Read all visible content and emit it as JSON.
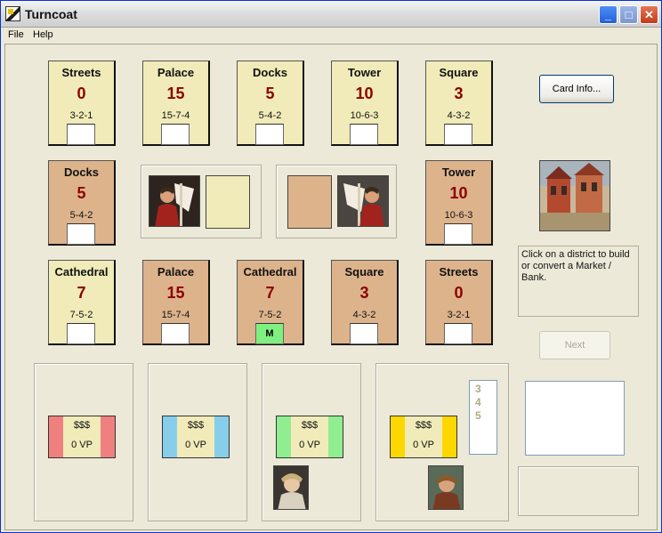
{
  "window": {
    "title": "Turncoat"
  },
  "menu": {
    "file": "File",
    "help": "Help"
  },
  "title_buttons": {
    "minimize": "_",
    "maximize": "□",
    "close": "✕"
  },
  "districts": [
    {
      "name": "Streets",
      "value": "0",
      "points": "3-2-1",
      "color": "yellow",
      "slot": ""
    },
    {
      "name": "Palace",
      "value": "15",
      "points": "15-7-4",
      "color": "yellow",
      "slot": ""
    },
    {
      "name": "Docks",
      "value": "5",
      "points": "5-4-2",
      "color": "yellow",
      "slot": ""
    },
    {
      "name": "Tower",
      "value": "10",
      "points": "10-6-3",
      "color": "yellow",
      "slot": ""
    },
    {
      "name": "Square",
      "value": "3",
      "points": "4-3-2",
      "color": "yellow",
      "slot": ""
    },
    {
      "name": "Docks",
      "value": "5",
      "points": "5-4-2",
      "color": "tan",
      "slot": ""
    },
    {
      "name": "Tower",
      "value": "10",
      "points": "10-6-3",
      "color": "tan",
      "slot": ""
    },
    {
      "name": "Cathedral",
      "value": "7",
      "points": "7-5-2",
      "color": "yellow",
      "slot": ""
    },
    {
      "name": "Palace",
      "value": "15",
      "points": "15-7-4",
      "color": "tan",
      "slot": ""
    },
    {
      "name": "Cathedral",
      "value": "7",
      "points": "7-5-2",
      "color": "tan",
      "slot": "M"
    },
    {
      "name": "Square",
      "value": "3",
      "points": "4-3-2",
      "color": "tan",
      "slot": ""
    },
    {
      "name": "Streets",
      "value": "0",
      "points": "3-2-1",
      "color": "tan",
      "slot": ""
    }
  ],
  "buttons": {
    "card_info": "Card Info...",
    "next": "Next"
  },
  "message": "Click on a district to build or convert a Market / Bank.",
  "players": [
    {
      "dollars": "$$$",
      "vp": "0 VP",
      "color": "#f08080"
    },
    {
      "dollars": "$$$",
      "vp": "0 VP",
      "color": "#87ceeb"
    },
    {
      "dollars": "$$$",
      "vp": "0 VP",
      "color": "#90ee90"
    },
    {
      "dollars": "$$$",
      "vp": "0 VP",
      "color": "#ffd700"
    }
  ],
  "numbers": [
    "3",
    "4",
    "5"
  ],
  "colors": {
    "yellow_card": "#f0ebb8",
    "tan_card": "#ddb38c",
    "value_red": "#8b0000",
    "market_green": "#7ff07f"
  }
}
